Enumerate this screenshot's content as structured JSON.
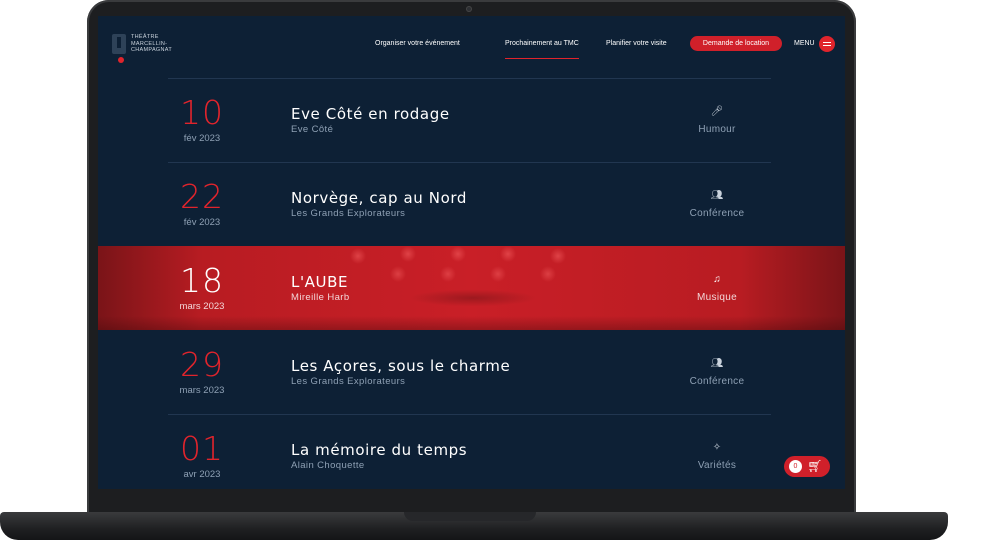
{
  "header": {
    "logo_lines": [
      "THÉÂTRE",
      "MARCELLIN-",
      "CHAMPAGNAT"
    ],
    "nav": [
      "Organiser votre événement",
      "Prochainement au TMC",
      "Planifier votre visite"
    ],
    "cta_label": "Demande de location",
    "menu_label": "MENU"
  },
  "events": [
    {
      "day": "10",
      "month": "fév 2023",
      "title": "Eve Côté en rodage",
      "artist": "Eve Côté",
      "genre": "Humour",
      "genre_icon": "microphone-icon",
      "icon_glyph": "🎤︎",
      "featured": false
    },
    {
      "day": "22",
      "month": "fév 2023",
      "title": "Norvège, cap au Nord",
      "artist": "Les Grands Explorateurs",
      "genre": "Conférence",
      "genre_icon": "audience-icon",
      "icon_glyph": "👥︎",
      "featured": false
    },
    {
      "day": "18",
      "month": "mars 2023",
      "title": "L'AUBE",
      "artist": "Mireille Harb",
      "genre": "Musique",
      "genre_icon": "music-notes-icon",
      "icon_glyph": "♫",
      "featured": true
    },
    {
      "day": "29",
      "month": "mars 2023",
      "title": "Les Açores, sous le charme",
      "artist": "Les Grands Explorateurs",
      "genre": "Conférence",
      "genre_icon": "audience-icon",
      "icon_glyph": "👥︎",
      "featured": false
    },
    {
      "day": "01",
      "month": "avr 2023",
      "title": "La mémoire du temps",
      "artist": "Alain Choquette",
      "genre": "Variétés",
      "genre_icon": "stars-icon",
      "icon_glyph": "✧",
      "featured": false
    }
  ],
  "cart": {
    "count": "0",
    "icon": "shopping-cart-icon",
    "icon_glyph": "🛒︎"
  },
  "colors": {
    "background": "#0d2035",
    "accent": "#e0242c",
    "featured_row": "#c91f27"
  }
}
